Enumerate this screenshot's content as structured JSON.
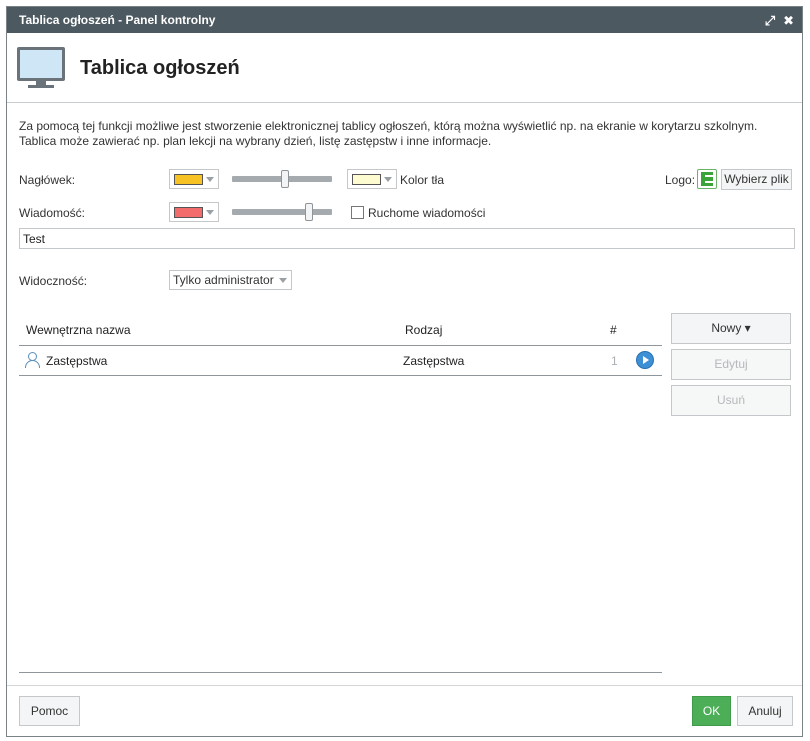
{
  "window": {
    "title": "Tablica ogłoszeń - Panel kontrolny",
    "maximize_glyph": "⤢",
    "close_glyph": "✖"
  },
  "header": {
    "title": "Tablica ogłoszeń",
    "icon": "monitor-icon"
  },
  "description": "Za pomocą tej funkcji możliwe jest stworzenie elektronicznej tablicy ogłoszeń, którą można wyświetlić np. na ekranie w korytarzu szkolnym. Tablica może zawierać np. plan lekcji na wybrany dzień, listę zastępstw i inne informacje.",
  "form": {
    "header_label": "Nagłówek:",
    "header_color": "#f7c223",
    "header_slider_value": 0.53,
    "bg_color": "#fdfcd0",
    "bg_color_label": "Kolor tła",
    "logo_label": "Logo:",
    "logo_button": "Wybierz plik",
    "message_label": "Wiadomość:",
    "message_color": "#f26c6c",
    "message_slider_value": 0.77,
    "moving_messages_label": "Ruchome wiadomości",
    "moving_messages_checked": false,
    "message_text": "Test",
    "visibility_label": "Widoczność:",
    "visibility_value": "Tylko administrator"
  },
  "table": {
    "columns": [
      "Wewnętrzna nazwa",
      "Rodzaj",
      "#"
    ],
    "rows": [
      {
        "name": "Zastępstwa",
        "type": "Zastępstwa",
        "count": "1"
      }
    ]
  },
  "side_buttons": {
    "new": "Nowy ▾",
    "edit": "Edytuj",
    "delete": "Usuń"
  },
  "footer": {
    "help": "Pomoc",
    "ok": "OK",
    "cancel": "Anuluj"
  }
}
